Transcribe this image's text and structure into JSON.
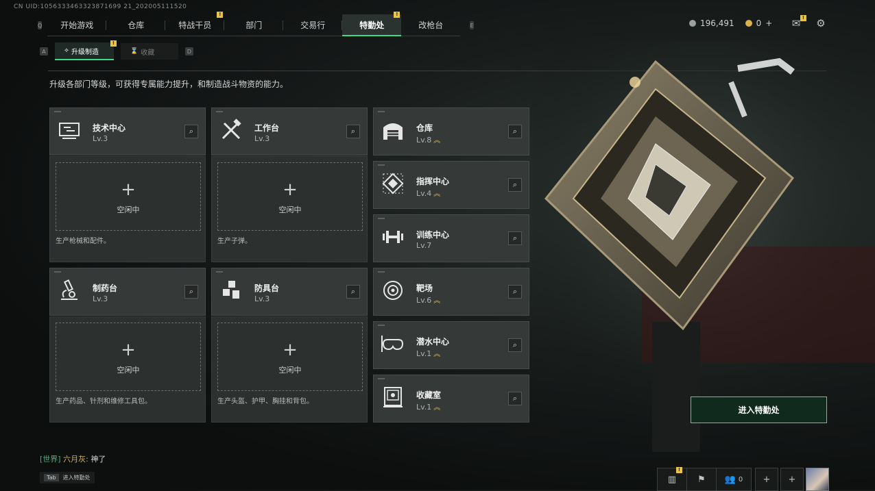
{
  "uid": "CN UID:1056333463323871699 21_202005111520",
  "top_nav": {
    "key_left": "Q",
    "key_right": "E",
    "tabs": [
      {
        "label": "开始游戏",
        "active": false,
        "badge": ""
      },
      {
        "label": "仓库",
        "active": false,
        "badge": ""
      },
      {
        "label": "特战干员",
        "active": false,
        "badge": "!"
      },
      {
        "label": "部门",
        "active": false,
        "badge": ""
      },
      {
        "label": "交易行",
        "active": false,
        "badge": ""
      },
      {
        "label": "特勤处",
        "active": true,
        "badge": "!"
      },
      {
        "label": "改枪台",
        "active": false,
        "badge": ""
      }
    ]
  },
  "currency": {
    "money": "196,491",
    "coins": "0",
    "plus": "+",
    "mail_badge": "!"
  },
  "sub_nav": {
    "key_left": "A",
    "key_right": "D",
    "tabs": [
      {
        "label": "升级制造",
        "active": true,
        "badge": "!"
      },
      {
        "label": "收藏",
        "active": false,
        "badge": ""
      }
    ]
  },
  "description": "升级各部门等级，可获得专属能力提升，和制造战斗物资的能力。",
  "production_depts": [
    {
      "name": "技术中心",
      "level": "Lv.3",
      "slot": {
        "plus": "+",
        "status": "空闲中"
      },
      "desc": "生产枪械和配件。"
    },
    {
      "name": "工作台",
      "level": "Lv.3",
      "slot": {
        "plus": "+",
        "status": "空闲中"
      },
      "desc": "生产子弹。"
    },
    {
      "name": "制药台",
      "level": "Lv.3",
      "slot": {
        "plus": "+",
        "status": "空闲中"
      },
      "desc": "生产药品、针剂和维修工具包。"
    },
    {
      "name": "防具台",
      "level": "Lv.3",
      "slot": {
        "plus": "+",
        "status": "空闲中"
      },
      "desc": "生产头盔、护甲、胸挂和背包。"
    }
  ],
  "facilities": [
    {
      "name": "仓库",
      "level": "Lv.8",
      "upgrade": true
    },
    {
      "name": "指挥中心",
      "level": "Lv.4",
      "upgrade": true
    },
    {
      "name": "训练中心",
      "level": "Lv.7",
      "upgrade": false
    },
    {
      "name": "靶场",
      "level": "Lv.6",
      "upgrade": true
    },
    {
      "name": "潜水中心",
      "level": "Lv.1",
      "upgrade": true
    },
    {
      "name": "收藏室",
      "level": "Lv.1",
      "upgrade": true
    }
  ],
  "upgrade_symbol": "︽",
  "search_symbol": "⌕",
  "enter_button": "进入特勤处",
  "chat": {
    "channel": "[世界]",
    "sender": "六月灰:",
    "message": "神了"
  },
  "tab_hint": {
    "key": "Tab",
    "label": "进入特勤处"
  },
  "bottom_bar": {
    "stats_badge": "!",
    "friends_count": "0",
    "plus": "+"
  },
  "colors": {
    "accent": "#3ddc84",
    "badge": "#e8c545",
    "upgrade": "#e2b746"
  }
}
